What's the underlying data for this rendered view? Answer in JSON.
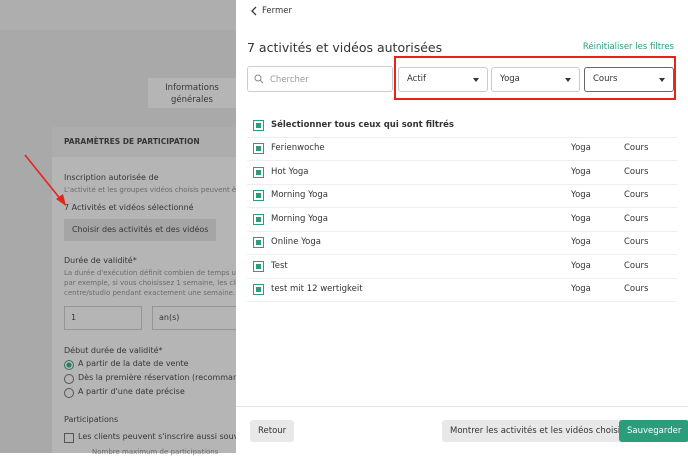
{
  "background": {
    "tab_label": "Informations générales",
    "card_header": "PARAMÈTRES DE PARTICIPATION",
    "registration_title": "Inscription autorisée de",
    "registration_desc": "L'activité et les groupes vidéos choisis peuvent être",
    "selected_count_text": "7 Activités et vidéos sélectionné",
    "choose_button": "Choisir des activités et des vidéos",
    "validity_title": "Durée de validité*",
    "validity_desc_1": "La durée d'exécution définit combien de temps un",
    "validity_desc_2": "par exemple, si vous choisissez 1 semaine, les clien",
    "validity_desc_3": "centre/studio pendant exactement une semaine.",
    "validity_value": "1",
    "validity_unit": "an(s)",
    "start_title": "Début durée de validité*",
    "start_options": [
      "A partir de la date de vente",
      "Dès la première réservation (recommandé",
      "A partir d'une date précise"
    ],
    "participations_title": "Participations",
    "participations_check": "Les clients peuvent s'inscrire aussi souvent",
    "participations_sub": "Nombre maximum de participations"
  },
  "panel": {
    "close_label": "Fermer",
    "title": "7 activités et vidéos autorisées",
    "reset_label": "Réinitialiser les filtres",
    "search_placeholder": "Chercher",
    "filters": {
      "status": "Actif",
      "category": "Yoga",
      "type": "Cours"
    },
    "select_all_label": "Sélectionner tous ceux qui sont filtrés",
    "items": [
      {
        "name": "Ferienwoche",
        "category": "Yoga",
        "type": "Cours"
      },
      {
        "name": "Hot Yoga",
        "category": "Yoga",
        "type": "Cours"
      },
      {
        "name": "Morning Yoga",
        "category": "Yoga",
        "type": "Cours"
      },
      {
        "name": "Morning Yoga",
        "category": "Yoga",
        "type": "Cours"
      },
      {
        "name": "Online Yoga",
        "category": "Yoga",
        "type": "Cours"
      },
      {
        "name": "Test",
        "category": "Yoga",
        "type": "Cours"
      },
      {
        "name": "test mit 12 wertigkeit",
        "category": "Yoga",
        "type": "Cours"
      }
    ],
    "footer": {
      "back_label": "Retour",
      "show_chosen_label": "Montrer les activités et les vidéos choisies",
      "save_label": "Sauvegarder"
    }
  },
  "colors": {
    "accent": "#2a9d7a",
    "highlight": "#e3261c"
  }
}
